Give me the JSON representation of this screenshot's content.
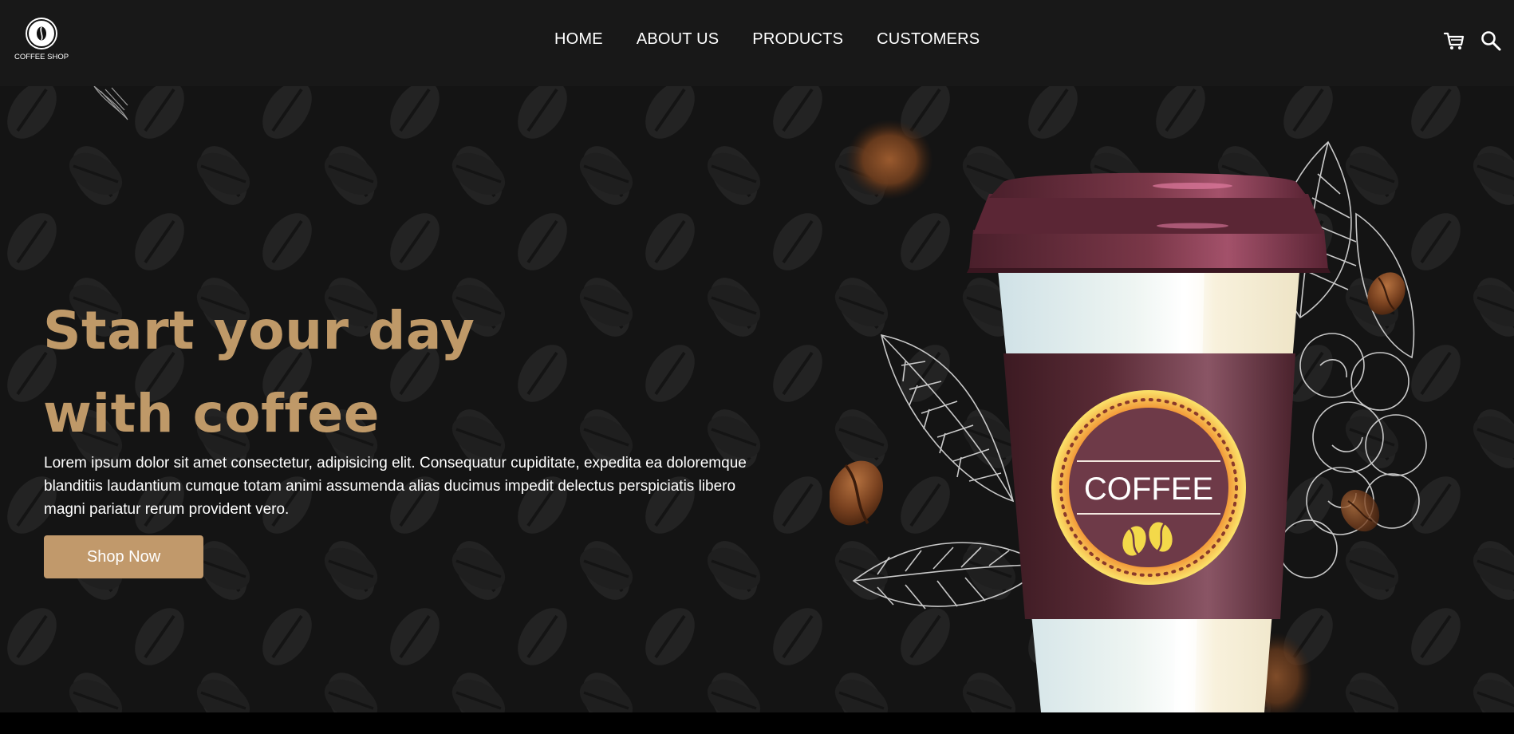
{
  "brand": {
    "name": "COFFEE SHOP",
    "logo_icon": "coffee-bean-icon"
  },
  "nav": {
    "items": [
      {
        "label": "HOME"
      },
      {
        "label": "ABOUT US"
      },
      {
        "label": "PRODUCTS"
      },
      {
        "label": "CUSTOMERS"
      }
    ],
    "icons": [
      "cart-icon",
      "search-icon"
    ]
  },
  "hero": {
    "headline_line1": "Start your day",
    "headline_line2": "with coffee",
    "description": "Lorem ipsum dolor sit amet consectetur, adipisicing elit. Consequatur cupiditate, expedita ea doloremque blanditiis laudantium cumque totam animi assumenda alias ducimus impedit delectus perspiciatis libero magni pariatur rerum provident vero.",
    "cta_label": "Shop Now",
    "cup_label": "COFFEE"
  },
  "colors": {
    "accent": "#bf9968",
    "nav_bg": "#181818",
    "hero_bg": "#141414",
    "cup_sleeve": "#5e2f3a",
    "cup_lid": "#6a2f3e",
    "badge_gold": "#f7c843"
  }
}
